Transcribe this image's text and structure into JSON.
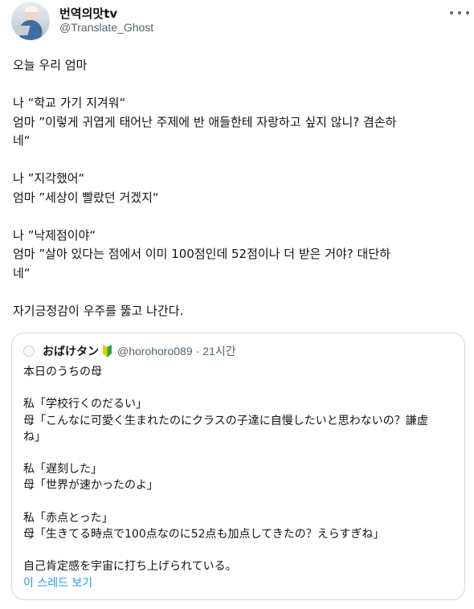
{
  "author": {
    "name": "번역의맛tv",
    "handle": "@Translate_Ghost"
  },
  "tweet": {
    "lines": [
      "오늘 우리 엄마",
      "",
      "나 “학교 가기 지겨워“",
      "엄마 ”이렇게 귀엽게 태어난 주제에 반 애들한테 자랑하고 싶지 않니? 겸손하",
      "네“",
      "",
      "나 ”지각했어“",
      "엄마 ”세상이 빨랐던 거겠지“",
      "",
      "나 ”낙제점이야“",
      "엄마 ”살아 있다는 점에서 이미 100점인데 52점이나 더 받은 거야? 대단하",
      "네“",
      "",
      "자기긍정감이 우주를 뚫고 나간다."
    ]
  },
  "quoted": {
    "name": "おばけタン",
    "handle": "@horohoro089",
    "separator": "·",
    "time": "21시간",
    "lines": [
      "本日のうちの母",
      "",
      "私「学校行くのだるい」",
      "母「こんなに可愛く生まれたのにクラスの子達に自慢したいと思わないの？謙虚",
      "ね」",
      "",
      "私「遅刻した」",
      "母「世界が速かったのよ」",
      "",
      "私「赤点とった」",
      "母「生きてる時点で100点なのに52点も加点してきたの？えらすぎね」",
      "",
      "自己肯定感を宇宙に打ち上げられている。"
    ],
    "show_thread": "이 스레드 보기"
  },
  "icons": {
    "more": "more-horizontal-icon",
    "badge": "beginner-mark-icon"
  },
  "colors": {
    "link": "#1d9bf0",
    "secondary_text": "#536471",
    "border": "#cfd9de"
  }
}
